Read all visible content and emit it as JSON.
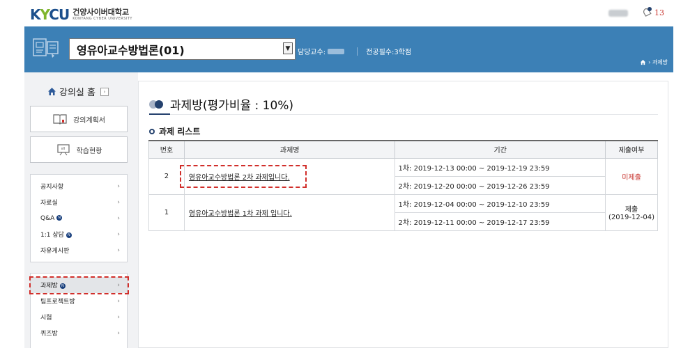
{
  "header": {
    "logo_mark_k": "K",
    "logo_mark_y": "Y",
    "logo_mark_cu": "CU",
    "logo_ko": "건양사이버대학교",
    "logo_en": "KONYANG CYBER UNIVERSITY",
    "alarm_count": "13"
  },
  "course": {
    "selected": "영유아교수방법론(01)",
    "professor_label": "담당교수:",
    "category": "전공필수:3학점",
    "breadcrumb_current": "과제방"
  },
  "sidebar": {
    "home_label": "강의실 홈",
    "buttons": [
      {
        "label": "강의계획서",
        "icon": "book-icon"
      },
      {
        "label": "학습현황",
        "icon": "board-icon"
      }
    ],
    "group1": [
      {
        "label": "공지사항",
        "badge": ""
      },
      {
        "label": "자료실",
        "badge": ""
      },
      {
        "label": "Q&A",
        "badge": "N"
      },
      {
        "label": "1:1 상담",
        "badge": "N"
      },
      {
        "label": "자유게시판",
        "badge": ""
      }
    ],
    "group2": [
      {
        "label": "과제방",
        "badge": "N",
        "active": true
      },
      {
        "label": "팀프로젝트방",
        "badge": ""
      },
      {
        "label": "시험",
        "badge": ""
      },
      {
        "label": "퀴즈방",
        "badge": ""
      }
    ],
    "arrow": "›"
  },
  "main": {
    "title": "과제방(평가비율 : 10%)",
    "subtitle": "과제 리스트",
    "table": {
      "headers": [
        "번호",
        "과제명",
        "기간",
        "제출여부"
      ],
      "rows": [
        {
          "no": "2",
          "name": "영유아교수방법론 2차 과제입니다.",
          "period1": "1차: 2019-12-13 00:00 ~ 2019-12-19 23:59",
          "period2": "2차: 2019-12-20 00:00 ~ 2019-12-26 23:59",
          "status": "미제출",
          "status_date": ""
        },
        {
          "no": "1",
          "name": "영유아교수방법론 1차 과제 입니다.",
          "period1": "1차: 2019-12-04 00:00 ~ 2019-12-10 23:59",
          "period2": "2차: 2019-12-11 00:00 ~ 2019-12-17 23:59",
          "status": "제출",
          "status_date": "(2019-12-04)"
        }
      ]
    }
  },
  "colors": {
    "band": "#3c80b6",
    "accent_navy": "#25426e",
    "highlight_red": "#d12e2a",
    "status_red": "#c8342e"
  }
}
